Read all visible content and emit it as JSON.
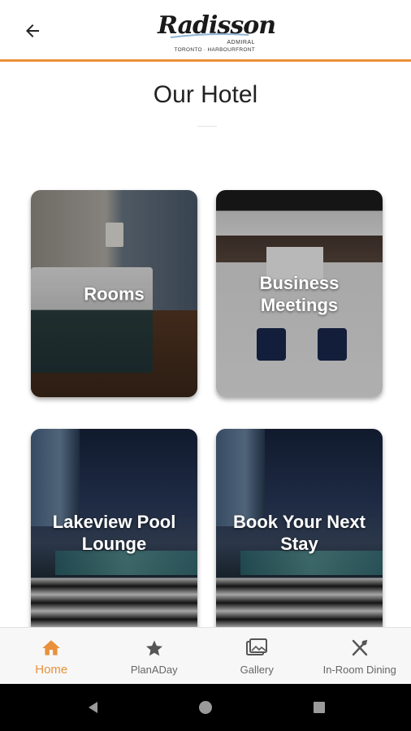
{
  "header": {
    "back_label": "Back",
    "logo": {
      "brand": "Radisson",
      "line1": "ADMIRAL",
      "line2": "TORONTO · HARBOURFRONT"
    },
    "accent_color": "#e8913a"
  },
  "page": {
    "title": "Our Hotel"
  },
  "cards": [
    {
      "label": "Rooms"
    },
    {
      "label": "Business Meetings"
    },
    {
      "label": "Lakeview Pool Lounge"
    },
    {
      "label": "Book Your Next Stay"
    }
  ],
  "bottom_nav": {
    "items": [
      {
        "label": "Home",
        "icon": "home-icon",
        "active": true
      },
      {
        "label": "PlanADay",
        "icon": "star-icon",
        "active": false
      },
      {
        "label": "Gallery",
        "icon": "gallery-icon",
        "active": false
      },
      {
        "label": "In-Room Dining",
        "icon": "fork-knife-icon",
        "active": false
      }
    ],
    "active_color": "#e8913a",
    "inactive_color": "#666666"
  },
  "system_nav": {
    "buttons": [
      "back-triangle-icon",
      "home-circle-icon",
      "recents-square-icon"
    ]
  }
}
